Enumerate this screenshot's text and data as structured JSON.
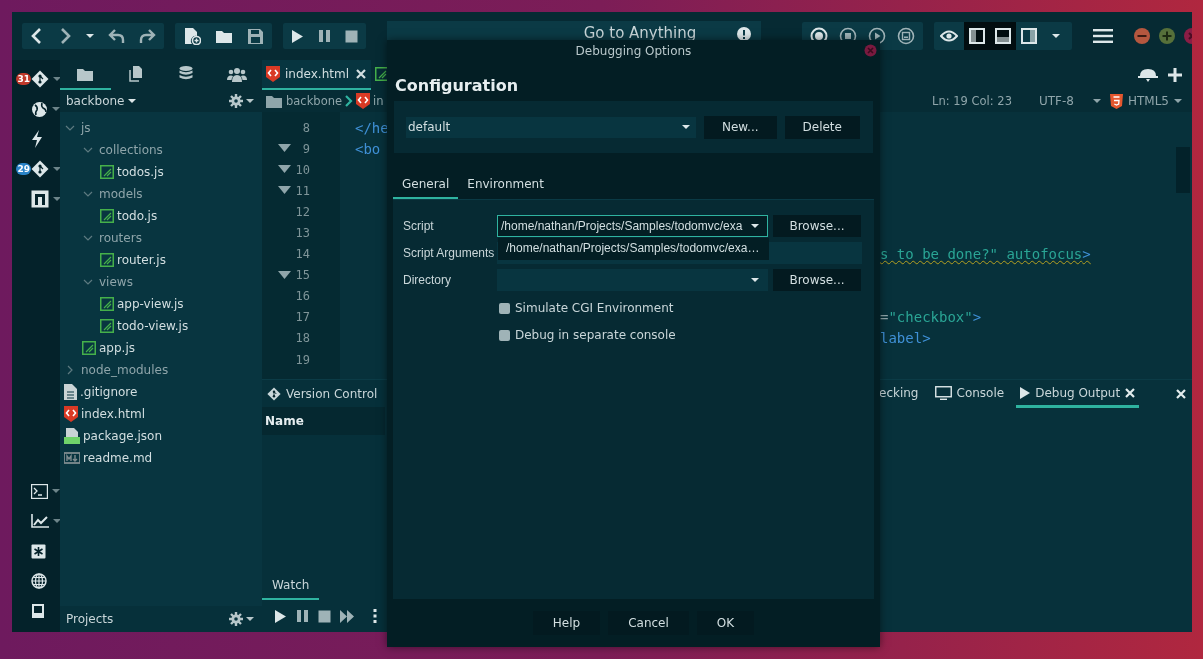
{
  "toolbar": {
    "search": {
      "placeholder": "Go to Anything"
    },
    "layout_toggles": [
      {
        "on": true
      },
      {
        "on": true
      },
      {
        "on": false
      }
    ]
  },
  "rail": {
    "notifications": {
      "count": "31"
    },
    "git_changes": {
      "count": "29"
    }
  },
  "sidebar": {
    "tabs": [
      {
        "selected": true
      },
      {
        "selected": false
      },
      {
        "selected": false
      },
      {
        "selected": false
      }
    ],
    "project": "backbone",
    "tree": [
      {
        "name": "js",
        "kind": "folder",
        "expanded": true,
        "children": [
          {
            "name": "collections",
            "kind": "folder",
            "expanded": true,
            "children": [
              {
                "name": "todos.js",
                "kind": "js"
              }
            ]
          },
          {
            "name": "models",
            "kind": "folder",
            "expanded": true,
            "children": [
              {
                "name": "todo.js",
                "kind": "js"
              }
            ]
          },
          {
            "name": "routers",
            "kind": "folder",
            "expanded": true,
            "children": [
              {
                "name": "router.js",
                "kind": "js"
              }
            ]
          },
          {
            "name": "views",
            "kind": "folder",
            "expanded": true,
            "children": [
              {
                "name": "app-view.js",
                "kind": "js"
              },
              {
                "name": "todo-view.js",
                "kind": "js"
              }
            ]
          },
          {
            "name": "app.js",
            "kind": "js"
          }
        ]
      },
      {
        "name": "node_modules",
        "kind": "folder",
        "expanded": false
      },
      {
        "name": ".gitignore",
        "kind": "file"
      },
      {
        "name": "index.html",
        "kind": "html"
      },
      {
        "name": "package.json",
        "kind": "json"
      },
      {
        "name": "readme.md",
        "kind": "md"
      }
    ],
    "footer": "Projects"
  },
  "editor": {
    "tabs": [
      {
        "label": "index.html",
        "kind": "html",
        "selected": true
      },
      {
        "kind": "js",
        "selected": false
      }
    ],
    "breadcrumb": [
      "backbone",
      "in"
    ],
    "status": {
      "position": "Ln: 19 Col: 23",
      "encoding": "UTF-8",
      "syntax": "HTML5"
    },
    "lines": [
      {
        "number": "8",
        "fold": false,
        "left": "</he"
      },
      {
        "number": "9",
        "fold": true,
        "left": "<bo"
      },
      {
        "number": "10",
        "fold": true
      },
      {
        "number": "11",
        "fold": true
      },
      {
        "number": "12",
        "fold": false
      },
      {
        "number": "13",
        "fold": false
      },
      {
        "number": "14",
        "fold": false,
        "warning": true,
        "right": [
          {
            "text": "s to be done?\" autofocus",
            "kind": "string"
          },
          {
            "text": ">",
            "kind": "tag"
          }
        ]
      },
      {
        "number": "15",
        "fold": true
      },
      {
        "number": "16",
        "fold": false
      },
      {
        "number": "17",
        "fold": false,
        "right": [
          {
            "text": "=",
            "kind": "plain"
          },
          {
            "text": "\"checkbox\"",
            "kind": "string"
          },
          {
            "text": ">",
            "kind": "tag"
          }
        ]
      },
      {
        "number": "18",
        "fold": false,
        "right": [
          {
            "text": "label>",
            "kind": "tag"
          }
        ]
      },
      {
        "number": "19",
        "fold": false
      }
    ]
  },
  "bottom_left": {
    "tab": "Version Control",
    "column": "Name",
    "lower_tab": {
      "label": "Watch",
      "selected": true
    }
  },
  "bottom_right": {
    "tabs": [
      {
        "label": "ecking",
        "selected": false
      },
      {
        "label": "Console",
        "selected": false
      },
      {
        "label": "Debug Output",
        "selected": true
      }
    ]
  },
  "dialog": {
    "title": "Debugging Options",
    "heading": "Configuration",
    "configuration": "default",
    "config_buttons": [
      "New...",
      "Delete"
    ],
    "tabs": [
      {
        "label": "General",
        "selected": true
      },
      {
        "label": "Environment",
        "selected": false
      }
    ],
    "fields": [
      {
        "label": "Script",
        "kind": "combo",
        "value": "/home/nathan/Projects/Samples/todomvc/exa",
        "focused": true,
        "button": "Browse..."
      },
      {
        "label": "Script Arguments",
        "kind": "text",
        "focused": false
      },
      {
        "label": "Directory",
        "kind": "combo",
        "focused": false,
        "button": "Browse..."
      }
    ],
    "suggestion": "/home/nathan/Projects/Samples/todomvc/exa…",
    "checkboxes": [
      {
        "label": "Simulate CGI Environment",
        "checked": false
      },
      {
        "label": "Debug in separate console",
        "checked": false
      }
    ],
    "buttons": [
      "Help",
      "Cancel",
      "OK"
    ]
  }
}
